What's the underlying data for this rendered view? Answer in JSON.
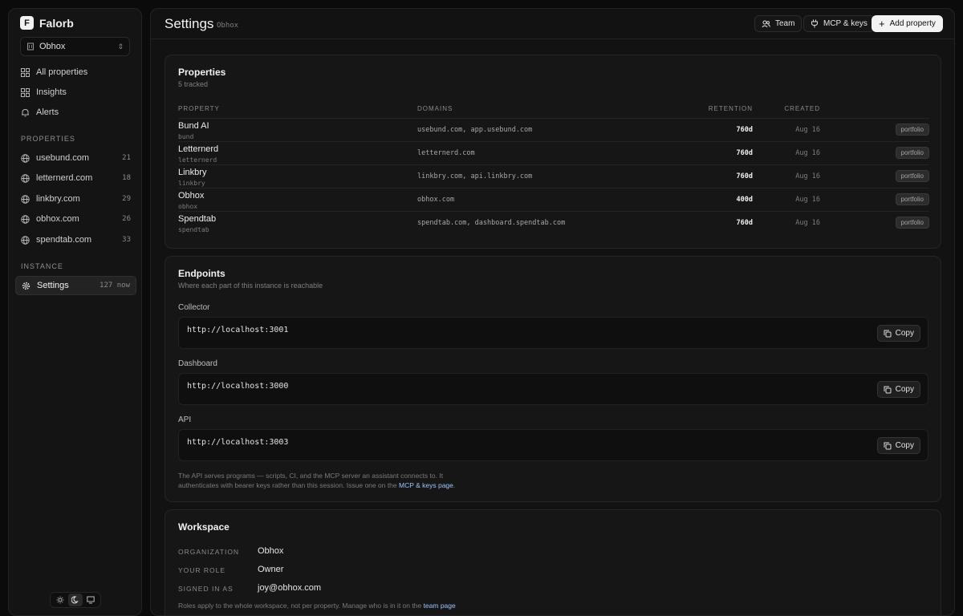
{
  "brand": {
    "logo_letter": "F",
    "name": "Falorb"
  },
  "workspace_selector": {
    "value": "Obhox"
  },
  "sidebar": {
    "nav": [
      {
        "label": "All properties",
        "icon": "grid-icon"
      },
      {
        "label": "Insights",
        "icon": "grid-icon"
      },
      {
        "label": "Alerts",
        "icon": "bell-icon"
      }
    ],
    "properties_heading": "PROPERTIES",
    "properties": [
      {
        "label": "usebund.com",
        "count": "21"
      },
      {
        "label": "letternerd.com",
        "count": "18"
      },
      {
        "label": "linkbry.com",
        "count": "29"
      },
      {
        "label": "obhox.com",
        "count": "26"
      },
      {
        "label": "spendtab.com",
        "count": "33"
      }
    ],
    "instance_heading": "INSTANCE",
    "settings": {
      "label": "Settings",
      "count": "127",
      "status": "now"
    }
  },
  "header": {
    "title": "Settings",
    "subtitle": "Obhox",
    "team_label": "Team",
    "keys_label": "MCP & keys",
    "add_label": "Add property"
  },
  "properties_card": {
    "title": "Properties",
    "subtitle": "5 tracked",
    "columns": {
      "property": "PROPERTY",
      "domains": "DOMAINS",
      "retention": "RETENTION",
      "created": "CREATED"
    },
    "rows": [
      {
        "name": "Bund AI",
        "slug": "bund",
        "domains": "usebund.com, app.usebund.com",
        "retention": "760d",
        "created": "Aug 16",
        "tag": "portfolio"
      },
      {
        "name": "Letternerd",
        "slug": "letternerd",
        "domains": "letternerd.com",
        "retention": "760d",
        "created": "Aug 16",
        "tag": "portfolio"
      },
      {
        "name": "Linkbry",
        "slug": "linkbry",
        "domains": "linkbry.com, api.linkbry.com",
        "retention": "760d",
        "created": "Aug 16",
        "tag": "portfolio"
      },
      {
        "name": "Obhox",
        "slug": "obhox",
        "domains": "obhox.com",
        "retention": "400d",
        "created": "Aug 16",
        "tag": "portfolio"
      },
      {
        "name": "Spendtab",
        "slug": "spendtab",
        "domains": "spendtab.com, dashboard.spendtab.com",
        "retention": "760d",
        "created": "Aug 16",
        "tag": "portfolio"
      }
    ]
  },
  "endpoints_card": {
    "title": "Endpoints",
    "subtitle": "Where each part of this instance is reachable",
    "copy_label": "Copy",
    "endpoints": [
      {
        "label": "Collector",
        "url": "http://localhost:3001"
      },
      {
        "label": "Dashboard",
        "url": "http://localhost:3000"
      },
      {
        "label": "API",
        "url": "http://localhost:3003"
      }
    ],
    "note_line1": "The API serves programs — scripts, CI, and the MCP server an assistant connects to. It",
    "note_line2": "authenticates with bearer keys rather than this session. Issue one on the",
    "note_link": "MCP & keys page",
    "note_end": "."
  },
  "workspace_card": {
    "title": "Workspace",
    "organization_label": "ORGANIZATION",
    "organization": "Obhox",
    "role_label": "YOUR ROLE",
    "role": "Owner",
    "signed_in_label": "SIGNED IN AS",
    "signed_in": "joy@obhox.com",
    "note": "Roles apply to the whole workspace, not per property. Manage who is in it on the",
    "note_link": "team page"
  },
  "colors": {
    "background": "#0b0b0b",
    "panel": "#141414",
    "link": "#9cc4ff",
    "primary_button": "#f3f3f3"
  }
}
